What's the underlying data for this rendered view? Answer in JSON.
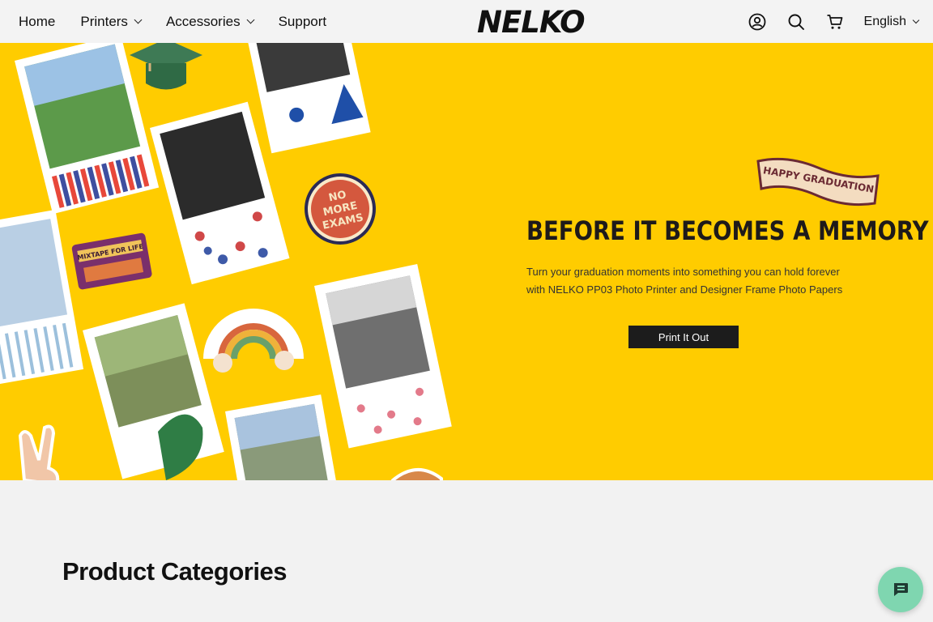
{
  "header": {
    "nav": [
      {
        "label": "Home",
        "has_dropdown": false
      },
      {
        "label": "Printers",
        "has_dropdown": true
      },
      {
        "label": "Accessories",
        "has_dropdown": true
      },
      {
        "label": "Support",
        "has_dropdown": false
      }
    ],
    "logo": "NELKO",
    "icons": [
      "account-icon",
      "search-icon",
      "cart-icon"
    ],
    "language": "English"
  },
  "banner": {
    "background": "#ffcc00",
    "title": "BEFORE IT BECOMES A MEMORY",
    "text": "Turn your graduation moments into something you can hold forever with NELKO PP03 Photo Printer and Designer Frame Photo Papers",
    "cta": "Print It Out",
    "ribbon": "HAPPY GRADUATION",
    "stickers": {
      "badge": "NO MORE EXAMS",
      "tape": "MIXTAPE FOR LIFE"
    }
  },
  "categories": {
    "title": "Product Categories"
  },
  "chat": {
    "icon": "chat-icon",
    "color": "#7fd6b0"
  }
}
